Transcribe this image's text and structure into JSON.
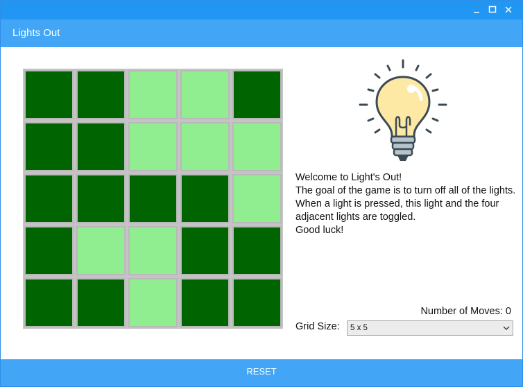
{
  "window": {
    "controls": [
      "minimize-icon",
      "maximize-icon",
      "close-icon"
    ]
  },
  "app": {
    "title": "Lights Out"
  },
  "board": {
    "size": 5,
    "cells": [
      [
        1,
        1,
        0,
        0,
        1
      ],
      [
        1,
        1,
        0,
        0,
        0
      ],
      [
        1,
        1,
        1,
        1,
        0
      ],
      [
        1,
        0,
        0,
        1,
        1
      ],
      [
        1,
        1,
        0,
        1,
        1
      ]
    ],
    "colors": {
      "on": "#006400",
      "off": "#90ee90"
    }
  },
  "info": {
    "lines": [
      "Welcome to Light's Out!",
      "The goal of the game is to turn off all of the lights.",
      "When a light is pressed, this light and the four adjacent lights are toggled.",
      "Good luck!"
    ],
    "icon": "lightbulb-icon"
  },
  "moves": {
    "text": "Number of Moves: 0"
  },
  "grid_size": {
    "label": "Grid Size:",
    "selected": "5 x 5"
  },
  "reset": {
    "label": "RESET"
  },
  "colors": {
    "titlebar": "#2196f3",
    "appbar": "#42a5f5",
    "button": "#42a5f5"
  }
}
